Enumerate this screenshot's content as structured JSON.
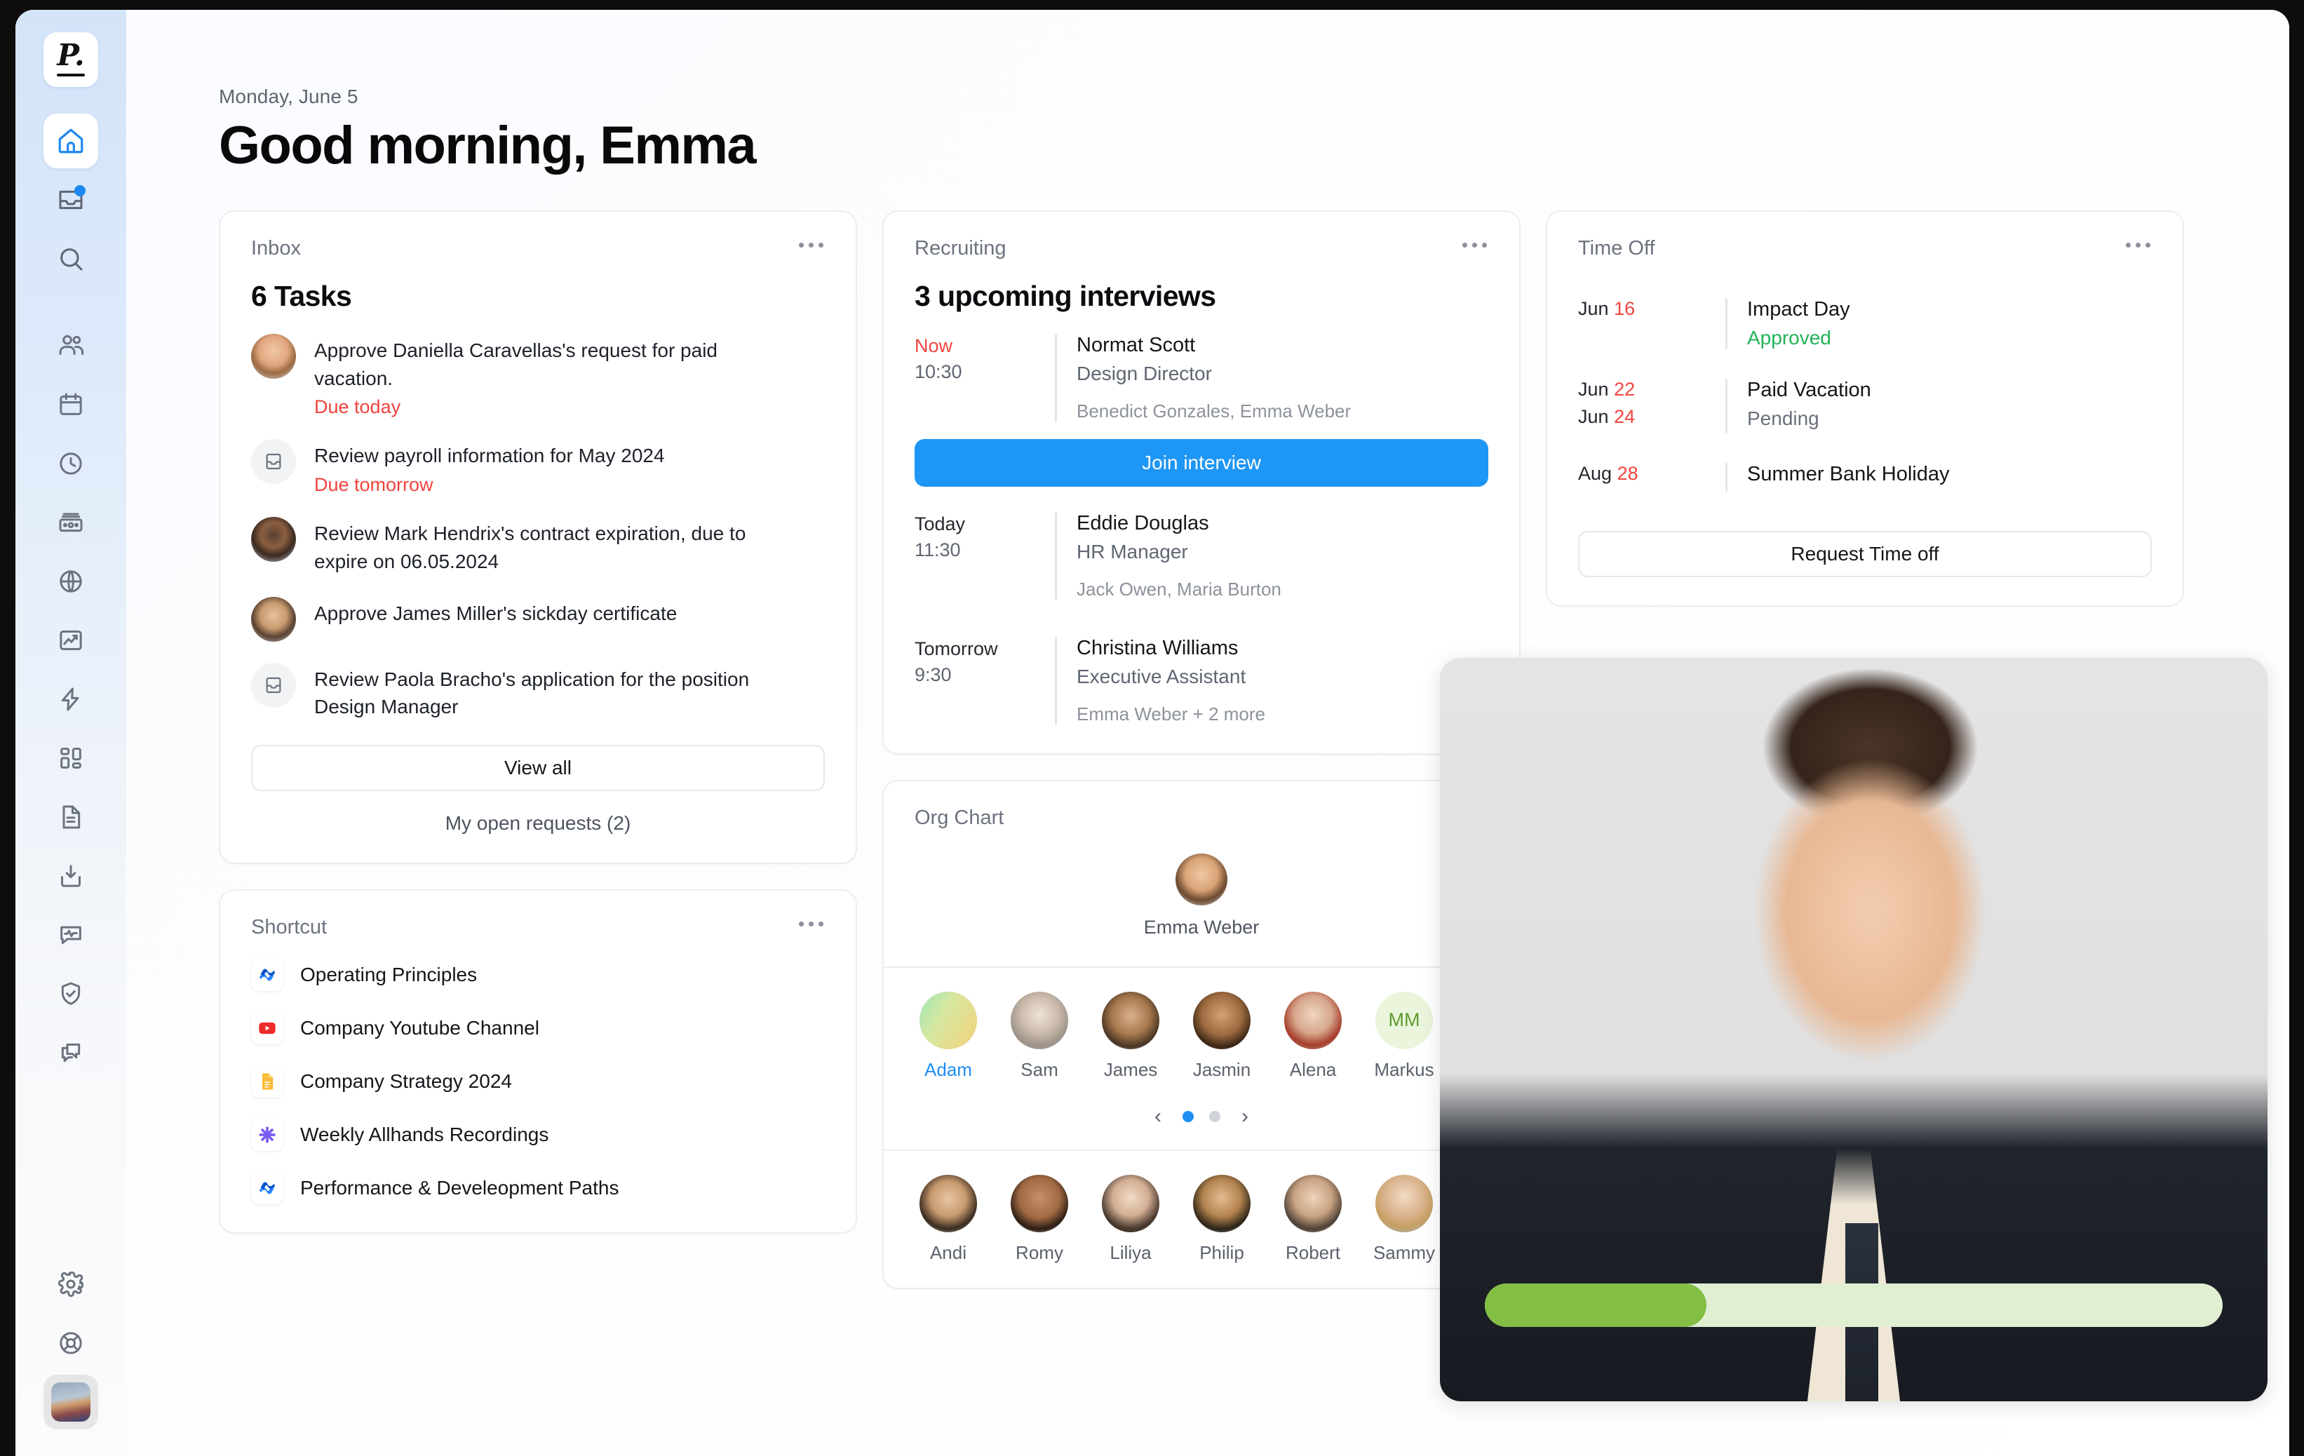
{
  "app": {
    "logo_letter": "P."
  },
  "sidebar": {
    "items": [
      {
        "name": "home",
        "icon": "home-icon",
        "active": true
      },
      {
        "name": "inbox",
        "icon": "inbox-icon",
        "badge": true
      },
      {
        "name": "search",
        "icon": "search-icon"
      },
      {
        "name": "people",
        "icon": "people-icon"
      },
      {
        "name": "calendar",
        "icon": "calendar-icon"
      },
      {
        "name": "time-tracking",
        "icon": "clock-icon"
      },
      {
        "name": "payroll",
        "icon": "money-icon"
      },
      {
        "name": "globe",
        "icon": "globe-icon"
      },
      {
        "name": "reports",
        "icon": "chart-trending-icon"
      },
      {
        "name": "automations",
        "icon": "lightning-icon"
      },
      {
        "name": "apps",
        "icon": "grid-icon"
      },
      {
        "name": "documents",
        "icon": "document-icon"
      },
      {
        "name": "imports",
        "icon": "download-icon"
      },
      {
        "name": "surveys",
        "icon": "pulse-chat-icon"
      },
      {
        "name": "compliance",
        "icon": "shield-check-icon"
      },
      {
        "name": "messages",
        "icon": "chat-bubbles-icon"
      },
      {
        "name": "settings",
        "icon": "gear-icon"
      },
      {
        "name": "help",
        "icon": "lifebuoy-icon"
      },
      {
        "name": "profile",
        "icon": "user-avatar"
      }
    ]
  },
  "header": {
    "date": "Monday, June 5",
    "greeting": "Good morning, Emma"
  },
  "inbox": {
    "title": "Inbox",
    "count_label": "6 Tasks",
    "tasks": [
      {
        "text": "Approve Daniella Caravellas's request for paid vacation.",
        "due": "Due today",
        "avatar": "p1"
      },
      {
        "text": "Review payroll information for May 2024",
        "due": "Due tomorrow",
        "avatar": "inbox-icon"
      },
      {
        "text": "Review Mark Hendrix's contract expiration, due to expire on 06.05.2024",
        "due": "",
        "avatar": "p2"
      },
      {
        "text": "Approve James Miller's sickday certificate",
        "due": "",
        "avatar": "p3"
      },
      {
        "text": "Review Paola Bracho's application for the position Design Manager",
        "due": "",
        "avatar": "inbox-icon"
      }
    ],
    "view_all_label": "View all",
    "open_requests_label": "My open requests (2)"
  },
  "shortcut": {
    "title": "Shortcut",
    "items": [
      {
        "label": "Operating Principles",
        "icon": "confluence-icon"
      },
      {
        "label": "Company Youtube Channel",
        "icon": "youtube-icon"
      },
      {
        "label": "Company Strategy 2024",
        "icon": "google-docs-icon"
      },
      {
        "label": "Weekly Allhands Recordings",
        "icon": "asterisk-icon"
      },
      {
        "label": "Performance & Develeopment Paths",
        "icon": "confluence-icon"
      }
    ]
  },
  "recruiting": {
    "title": "Recruiting",
    "headline": "3 upcoming interviews",
    "join_label": "Join interview",
    "interviews": [
      {
        "when": "Now",
        "now": true,
        "time": "10:30",
        "name": "Normat Scott",
        "role": "Design Director",
        "people": "Benedict Gonzales, Emma Weber"
      },
      {
        "when": "Today",
        "now": false,
        "time": "11:30",
        "name": "Eddie Douglas",
        "role": "HR Manager",
        "people": "Jack Owen, Maria Burton"
      },
      {
        "when": "Tomorrow",
        "now": false,
        "time": "9:30",
        "name": "Christina Williams",
        "role": "Executive Assistant",
        "people": "Emma Weber + 2 more"
      }
    ]
  },
  "timeoff": {
    "title": "Time Off",
    "request_label": "Request Time off",
    "entries": [
      {
        "dates": [
          {
            "month": "Jun",
            "day": "16"
          }
        ],
        "name": "Impact Day",
        "status": "Approved",
        "status_kind": "approved"
      },
      {
        "dates": [
          {
            "month": "Jun",
            "day": "22"
          },
          {
            "month": "Jun",
            "day": "24"
          }
        ],
        "name": "Paid Vacation",
        "status": "Pending",
        "status_kind": "pending"
      },
      {
        "dates": [
          {
            "month": "Aug",
            "day": "28"
          }
        ],
        "name": "Summer Bank Holiday",
        "status": "",
        "status_kind": "none"
      }
    ]
  },
  "orgchart": {
    "title": "Org Chart",
    "root": {
      "name": "Emma Weber",
      "avatar": "p4"
    },
    "row1": [
      {
        "name": "Adam",
        "avatar": "p7",
        "selected": true
      },
      {
        "name": "Sam",
        "avatar": "p8",
        "selected": false
      },
      {
        "name": "James",
        "avatar": "p9",
        "selected": false
      },
      {
        "name": "Jasmin",
        "avatar": "p10",
        "selected": false
      },
      {
        "name": "Alena",
        "avatar": "p11",
        "selected": false
      },
      {
        "name": "Markus",
        "avatar": "initials",
        "initials": "MM",
        "selected": false
      }
    ],
    "row2": [
      {
        "name": "Andi",
        "avatar": "p12"
      },
      {
        "name": "Romy",
        "avatar": "p13"
      },
      {
        "name": "Liliya",
        "avatar": "p14"
      },
      {
        "name": "Philip",
        "avatar": "p15"
      },
      {
        "name": "Robert",
        "avatar": "p16"
      },
      {
        "name": "Sammy",
        "avatar": "p17"
      }
    ],
    "pager": {
      "prev": "‹",
      "next": "›",
      "pages": 2,
      "active": 0
    }
  },
  "video_overlay": {
    "progress_percent": 30
  },
  "colors": {
    "accent_blue": "#1e96f5",
    "danger_red": "#f0443e",
    "success_green": "#22b358",
    "progress_green": "#82bf44",
    "progress_track": "#e0eed2",
    "sidebar_top": "#d3e4f9"
  }
}
